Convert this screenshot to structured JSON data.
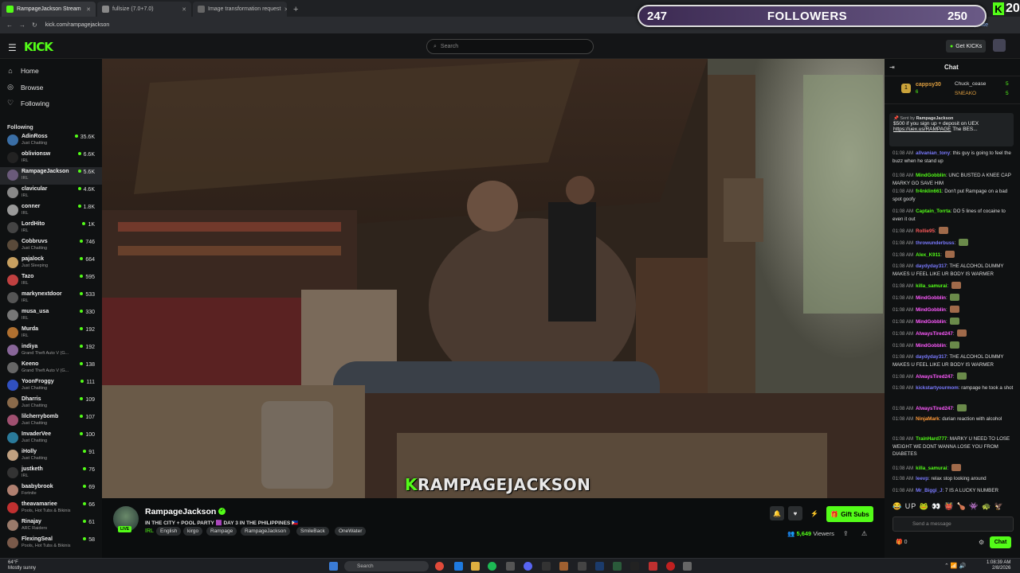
{
  "browser": {
    "tabs": [
      {
        "label": "RampageJackson Stream"
      },
      {
        "label": "fullsize (7.0+7.0)"
      },
      {
        "label": "Image transformation request"
      }
    ],
    "url": "kick.com/rampagejackson",
    "update_label": "Click to update"
  },
  "followers_overlay": {
    "current": "247",
    "label": "FOLLOWERS",
    "goal": "250",
    "badge": "20"
  },
  "site": {
    "logo": "KICK",
    "search_placeholder": "Search",
    "get_kicks": "Get KICKs"
  },
  "sidebar": {
    "nav": [
      {
        "label": "Home",
        "icon": "home-icon"
      },
      {
        "label": "Browse",
        "icon": "compass-icon"
      },
      {
        "label": "Following",
        "icon": "heart-icon"
      }
    ],
    "following_label": "Following",
    "channels": [
      {
        "name": "AdinRoss",
        "category": "Just Chatting",
        "viewers": "35.6K",
        "color": "#3a6ea5"
      },
      {
        "name": "oblivionsw",
        "category": "IRL",
        "viewers": "6.6K",
        "color": "#222"
      },
      {
        "name": "RampageJackson",
        "category": "IRL",
        "viewers": "5.6K",
        "color": "#6a5a7a"
      },
      {
        "name": "clavicular",
        "category": "IRL",
        "viewers": "4.6K",
        "color": "#888"
      },
      {
        "name": "conner",
        "category": "IRL",
        "viewers": "1.8K",
        "color": "#999"
      },
      {
        "name": "LordHito",
        "category": "IRL",
        "viewers": "1K",
        "color": "#444"
      },
      {
        "name": "Cobbruvs",
        "category": "Just Chatting",
        "viewers": "746",
        "color": "#5a4a3a"
      },
      {
        "name": "pajalock",
        "category": "Just Sleeping",
        "viewers": "664",
        "color": "#c8a060"
      },
      {
        "name": "Tazo",
        "category": "IRL",
        "viewers": "595",
        "color": "#c04040"
      },
      {
        "name": "markynextdoor",
        "category": "IRL",
        "viewers": "533",
        "color": "#555"
      },
      {
        "name": "musa_usa",
        "category": "IRL",
        "viewers": "330",
        "color": "#777"
      },
      {
        "name": "Murda",
        "category": "IRL",
        "viewers": "192",
        "color": "#b07030"
      },
      {
        "name": "indiya",
        "category": "Grand Theft Auto V (G...",
        "viewers": "192",
        "color": "#886699"
      },
      {
        "name": "Keeno",
        "category": "Grand Theft Auto V (G...",
        "viewers": "138",
        "color": "#666"
      },
      {
        "name": "YoonFroggy",
        "category": "Just Chatting",
        "viewers": "111",
        "color": "#3050c0"
      },
      {
        "name": "Dharris",
        "category": "Just Chatting",
        "viewers": "109",
        "color": "#8a6a4a"
      },
      {
        "name": "lilcherrybomb",
        "category": "Just Chatting",
        "viewers": "107",
        "color": "#a05070"
      },
      {
        "name": "InvaderVee",
        "category": "Just Chatting",
        "viewers": "100",
        "color": "#2a7a9a"
      },
      {
        "name": "iHolly",
        "category": "Just Chatting",
        "viewers": "91",
        "color": "#c0a080"
      },
      {
        "name": "justketh",
        "category": "IRL",
        "viewers": "76",
        "color": "#333"
      },
      {
        "name": "baabybrook",
        "category": "Fortnite",
        "viewers": "69",
        "color": "#b08070"
      },
      {
        "name": "theavamariee",
        "category": "Pools, Hot Tubs & Bikinis",
        "viewers": "66",
        "color": "#c03030"
      },
      {
        "name": "Rinajay",
        "category": "ARC Raiders",
        "viewers": "61",
        "color": "#9a7a6a"
      },
      {
        "name": "FlexingSeal",
        "category": "Pools, Hot Tubs & Bikinis",
        "viewers": "58",
        "color": "#7a5a4a"
      }
    ]
  },
  "video": {
    "overlay_name": "RAMPAGEJACKSON"
  },
  "stream": {
    "name": "RampageJackson",
    "live": "LIVE",
    "title": "IN THE CITY + POOL PARTY 🟪 DAY 3 IN THE PHILIPPINES 🇵🇭",
    "category": "IRL",
    "tags": [
      "English",
      "kirgo",
      "Rampage",
      "RampageJackson",
      "SmileBack",
      "OneWater"
    ],
    "gift_subs": "Gift Subs",
    "viewers": "5,649",
    "viewers_label": "Viewers"
  },
  "chat": {
    "title": "Chat",
    "leaderboard": [
      {
        "name": "cappsy30",
        "count": "6"
      },
      {
        "name": "Chuck_cease",
        "count": "5"
      },
      {
        "name": "SNEAKO",
        "count": "5"
      }
    ],
    "pinned": {
      "sent_by": "Sent by",
      "sender": "RampageJackson",
      "text": "$500 if you sign up + deposit on UEX",
      "link": "https://uex.us/RAMPAGE",
      "tail": "The BES..."
    },
    "messages": [
      {
        "time": "01:08 AM",
        "user": "allvanian_tony",
        "color": "#7a7aff",
        "text": "this guy is going to feel the buzz when he stand up"
      },
      {
        "time": "01:08 AM",
        "user": "MindGobblin",
        "color": "#53fc18",
        "text": "UNC BUSTED A KNEE CAP MARKY GO SAVE HIM"
      },
      {
        "time": "01:08 AM",
        "user": "fr4nklin661",
        "color": "#53fc18",
        "text": "Don't put Rampage on a bad spot goofy"
      },
      {
        "time": "01:08 AM",
        "user": "Captain_Torrta",
        "color": "#53fc18",
        "text": "DO 5 lines of cocaine to even it out"
      },
      {
        "time": "01:08 AM",
        "user": "Rollie95",
        "color": "#ff5a5a",
        "text": ""
      },
      {
        "time": "01:08 AM",
        "user": "throwunderbuss",
        "color": "#7a7aff",
        "text": ""
      },
      {
        "time": "01:08 AM",
        "user": "Alex_K911",
        "color": "#53fc18",
        "text": ""
      },
      {
        "time": "01:08 AM",
        "user": "daydyday317",
        "color": "#7a7aff",
        "text": "THE ALCOHOL DUMMY MAKES U FEEL LIKE UR BODY IS WARMER"
      },
      {
        "time": "01:08 AM",
        "user": "killa_samurai",
        "color": "#53fc18",
        "text": ""
      },
      {
        "time": "01:08 AM",
        "user": "MindGobblin",
        "color": "#ff5aff",
        "text": ""
      },
      {
        "time": "01:08 AM",
        "user": "MindGobblin",
        "color": "#ff5aff",
        "text": ""
      },
      {
        "time": "01:08 AM",
        "user": "MindGobblin",
        "color": "#ff5aff",
        "text": ""
      },
      {
        "time": "01:08 AM",
        "user": "AlwaysTired247",
        "color": "#ff5aff",
        "text": ""
      },
      {
        "time": "01:08 AM",
        "user": "MindGobblin",
        "color": "#ff5aff",
        "text": ""
      },
      {
        "time": "01:08 AM",
        "user": "daydyday317",
        "color": "#7a7aff",
        "text": "THE ALCOHOL DUMMY MAKES U FEEL LIKE UR BODY IS WARMER"
      },
      {
        "time": "01:08 AM",
        "user": "AlwaysTired247",
        "color": "#ff5aff",
        "text": ""
      },
      {
        "time": "01:08 AM",
        "user": "kickstartyourmom",
        "color": "#7a7aff",
        "text": "rampage he took a shot"
      },
      {
        "time": "01:08 AM",
        "user": "AlwaysTired247",
        "color": "#ff5aff",
        "text": ""
      },
      {
        "time": "01:08 AM",
        "user": "NinjaMark",
        "color": "#ff9a3a",
        "text": "durian reaction with alcohol"
      },
      {
        "time": "01:08 AM",
        "user": "TrainHard777",
        "color": "#53fc18",
        "text": "MARKY U NEED TO LOSE WEIGHT WE DONT WANNA LOSE YOU FROM DIABETES"
      },
      {
        "time": "01:08 AM",
        "user": "killa_samurai",
        "color": "#53fc18",
        "text": ""
      },
      {
        "time": "01:08 AM",
        "user": "leevp",
        "color": "#7a7aff",
        "text": "relax stop looking around"
      },
      {
        "time": "01:08 AM",
        "user": "Mr_Biggi_J",
        "color": "#7a7aff",
        "text": "7 IS A LUCKY NUMBER"
      }
    ],
    "emote_row": "😂 UP 🐸 👀 👹 🍗 👾 🐢 🦅",
    "input_placeholder": "Send a message",
    "send_label": "Chat",
    "count": "0"
  },
  "taskbar": {
    "weather_temp": "64°F",
    "weather_desc": "Mostly sunny",
    "search": "Search",
    "time": "1:08:39 AM",
    "date": "2/8/2026"
  }
}
